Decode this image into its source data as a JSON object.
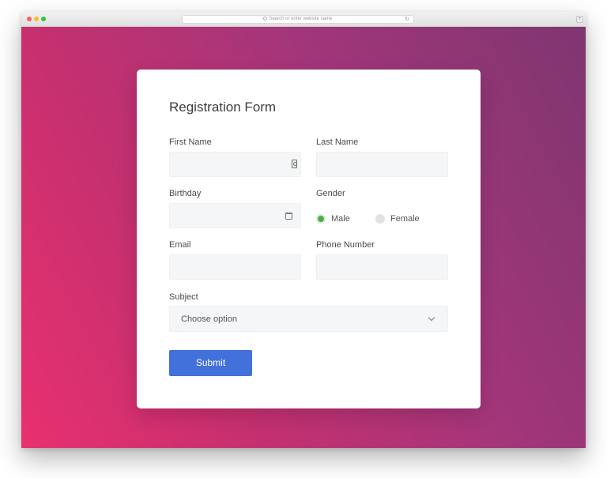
{
  "browser": {
    "url_placeholder": "Search or enter website name"
  },
  "form": {
    "title": "Registration Form",
    "first_name_label": "First Name",
    "last_name_label": "Last Name",
    "birthday_label": "Birthday",
    "gender_label": "Gender",
    "gender_options": [
      {
        "label": "Male",
        "checked": true
      },
      {
        "label": "Female",
        "checked": false
      }
    ],
    "email_label": "Email",
    "phone_label": "Phone Number",
    "subject_label": "Subject",
    "subject_selected": "Choose option",
    "submit_label": "Submit"
  },
  "colors": {
    "accent": "#4371db",
    "radio_checked": "#4cae4c",
    "gradient_start": "#e8306f",
    "gradient_end": "#7f3670"
  },
  "icons": {
    "contact": "contact-card-icon",
    "calendar": "calendar-icon",
    "chevron": "chevron-down-icon"
  }
}
